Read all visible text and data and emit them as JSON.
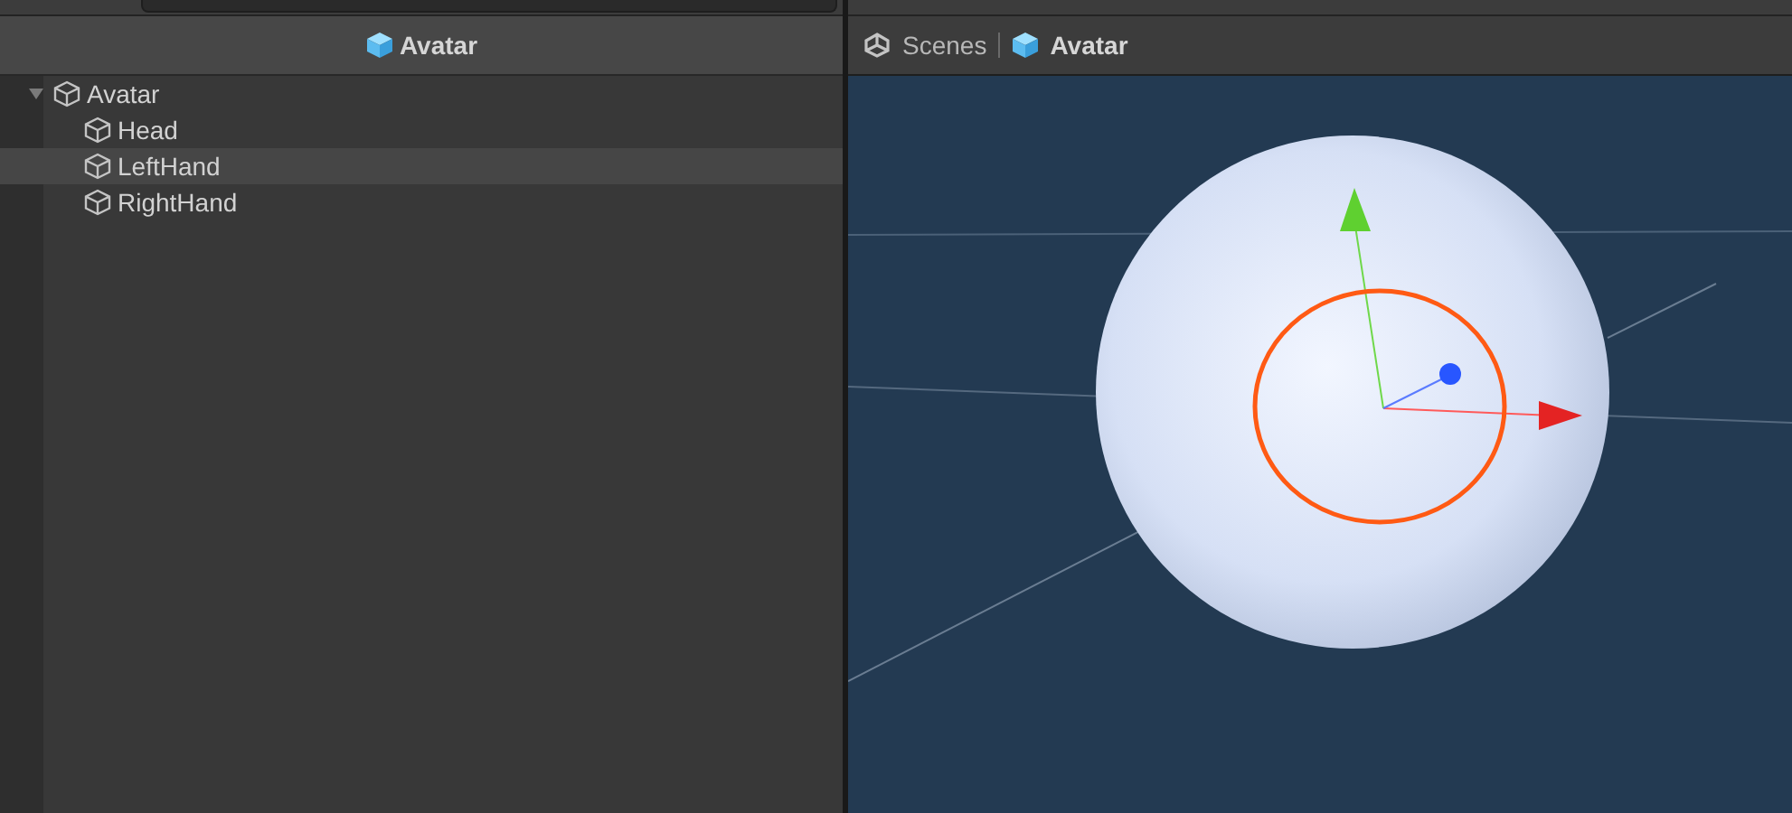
{
  "hierarchy": {
    "title": "Avatar",
    "tree": [
      {
        "label": "Avatar",
        "expanded": true,
        "selected": false,
        "children": [
          {
            "label": "Head",
            "selected": false
          },
          {
            "label": "LeftHand",
            "selected": true
          },
          {
            "label": "RightHand",
            "selected": false
          }
        ]
      }
    ]
  },
  "scene": {
    "breadcrumb": [
      {
        "label": "Scenes",
        "kind": "root"
      },
      {
        "label": "Avatar",
        "kind": "prefab"
      }
    ]
  }
}
